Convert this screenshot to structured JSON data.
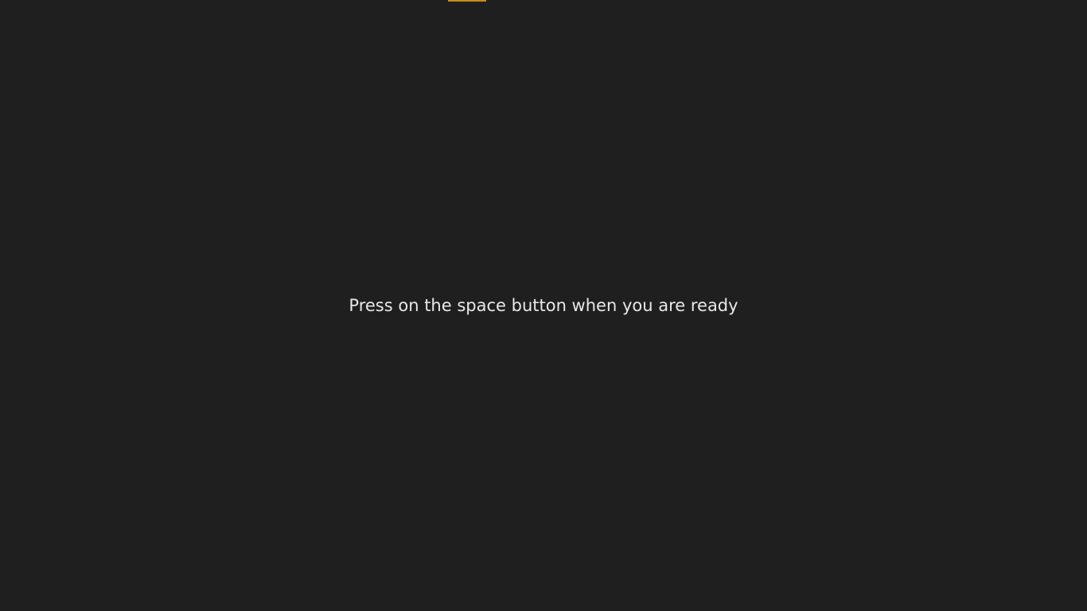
{
  "screen": {
    "background_color": "#1f1f1f",
    "accent_color": "#c98a1e",
    "text_color": "#e8e8e8",
    "prompt_text": "Press on the space button when you are ready"
  }
}
